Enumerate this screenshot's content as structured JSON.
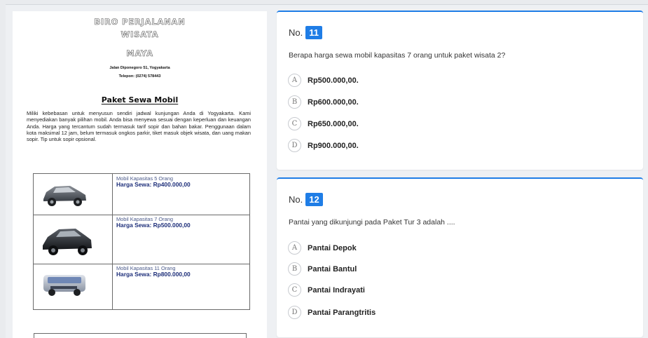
{
  "document": {
    "title_line1": "BIRO PERJALANAN",
    "title_line2": "WISATA",
    "title_line3": "MAYA",
    "address": "Jalan Diponegoro 51, Yogyakarta",
    "phone": "Telepon: (0274) 578443",
    "section_title": "Paket Sewa Mobil",
    "paragraph": "Miliki kebebasan untuk menyusun sendiri jadwal kunjungan Anda di Yogyakarta. Kami menyediakan banyak pilihan mobil. Anda bisa menyewa sesuai dengan keperluan dan keuangan Anda. Harga yang tercantum sudah termasuk tarif sopir dan bahan bakar. Penggunaan dalam kota maksimal 12 jam, belum termasuk ongkos parkir, tiket masuk objek wisata, dan uang makan sopir. Tip untuk sopir opsional.",
    "cars": [
      {
        "caption": "Mobil Kapasitas 5 Orang",
        "price": "Harga Sewa: Rp400.000,00"
      },
      {
        "caption": "Mobil Kapasitas 7 Orang",
        "price": "Harga Sewa: Rp500.000,00"
      },
      {
        "caption": "Mobil Kapasitas 11 Orang",
        "price": "Harga Sewa: Rp800.000,00"
      }
    ]
  },
  "questions": [
    {
      "number_label": "No.",
      "number": "11",
      "text": "Berapa harga sewa mobil kapasitas 7 orang untuk paket wisata 2?",
      "options": [
        {
          "letter": "A",
          "text": "Rp500.000,00."
        },
        {
          "letter": "B",
          "text": "Rp600.000,00."
        },
        {
          "letter": "C",
          "text": "Rp650.000,00."
        },
        {
          "letter": "D",
          "text": "Rp900.000,00."
        }
      ]
    },
    {
      "number_label": "No.",
      "number": "12",
      "text": "Pantai yang dikunjungi pada Paket Tur 3 adalah ....",
      "options": [
        {
          "letter": "A",
          "text": "Pantai Depok"
        },
        {
          "letter": "B",
          "text": "Pantai Bantul"
        },
        {
          "letter": "C",
          "text": "Pantai Indrayati"
        },
        {
          "letter": "D",
          "text": "Pantai Parangtritis"
        }
      ]
    }
  ],
  "colors": {
    "accent": "#1f7de6",
    "price_text": "#1e2f7a"
  }
}
